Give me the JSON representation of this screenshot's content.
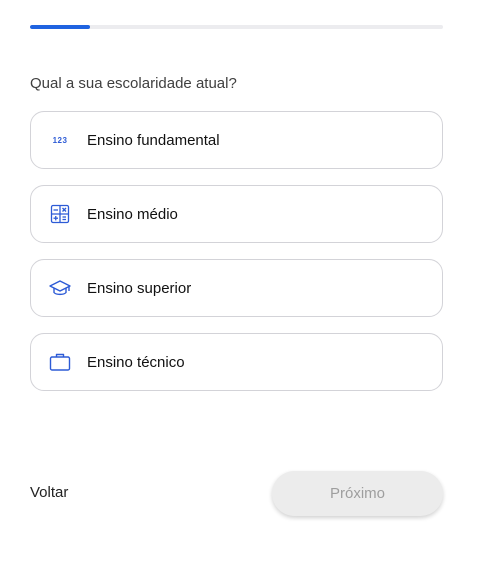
{
  "progress": {
    "fraction": 0.145,
    "color": "#1f63e0"
  },
  "question": "Qual a sua escolaridade atual?",
  "options": [
    {
      "label": "Ensino fundamental",
      "icon": "numbers-123-icon",
      "icon_text": "123"
    },
    {
      "label": "Ensino médio",
      "icon": "calculator-icon"
    },
    {
      "label": "Ensino superior",
      "icon": "graduation-cap-icon"
    },
    {
      "label": "Ensino técnico",
      "icon": "briefcase-icon"
    }
  ],
  "footer": {
    "back_label": "Voltar",
    "next_label": "Próximo",
    "next_enabled": false
  },
  "colors": {
    "accent": "#2d5bd6",
    "border": "#d3d3d8",
    "disabled_bg": "#ececec"
  }
}
